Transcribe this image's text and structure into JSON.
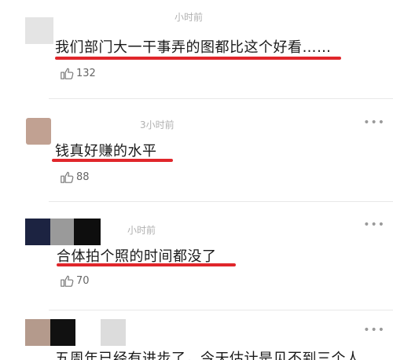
{
  "colors": {
    "underline": "#e0262b",
    "meta": "#b0b0b0"
  },
  "more_icon": "ellipsis-icon",
  "like_icon": "thumbs-up-icon",
  "comments": [
    {
      "time": "小时前",
      "text": "我们部门大一干事弄的图都比这个好看……",
      "likes": "132"
    },
    {
      "time": "3小时前",
      "text": "钱真好赚的水平",
      "likes": "88"
    },
    {
      "time": "小时前",
      "text": "合体拍个照的时间都没了",
      "likes": "70"
    },
    {
      "time": "",
      "text": "五周年已经有进步了，今天估计是见不到三个人",
      "likes": ""
    }
  ]
}
